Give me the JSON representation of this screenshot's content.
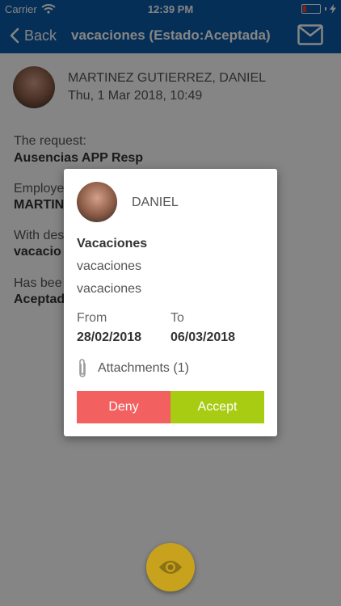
{
  "status_bar": {
    "carrier": "Carrier",
    "time": "12:39 PM"
  },
  "nav": {
    "back_label": "Back",
    "title": "vacaciones (Estado:Aceptada)"
  },
  "message": {
    "sender_name": "MARTINEZ GUTIERREZ, DANIEL",
    "date": "Thu, 1 Mar 2018, 10:49",
    "request_label": "The request:",
    "request_value": "Ausencias APP Resp",
    "employee_label": "Employe",
    "employee_value": "MARTIN",
    "description_label": "With des",
    "description_value": "vacacio",
    "state_label": "Has bee",
    "state_value": "Aceptad"
  },
  "modal": {
    "name": "DANIEL",
    "type": "Vacaciones",
    "line1": "vacaciones",
    "line2": "vacaciones",
    "from_label": "From",
    "to_label": "To",
    "from_date": "28/02/2018",
    "to_date": "06/03/2018",
    "attachments_label": "Attachments (1)",
    "deny_label": "Deny",
    "accept_label": "Accept"
  },
  "icons": {
    "wifi": "wifi-icon",
    "battery": "battery-icon",
    "charging": "charging-icon",
    "back": "chevron-left-icon",
    "mail": "mail-icon",
    "attachment": "paperclip-icon",
    "eye": "eye-icon"
  },
  "colors": {
    "primary": "#0b5aa8",
    "deny": "#f26060",
    "accept": "#a8cc12",
    "fab": "#c8a21c"
  }
}
